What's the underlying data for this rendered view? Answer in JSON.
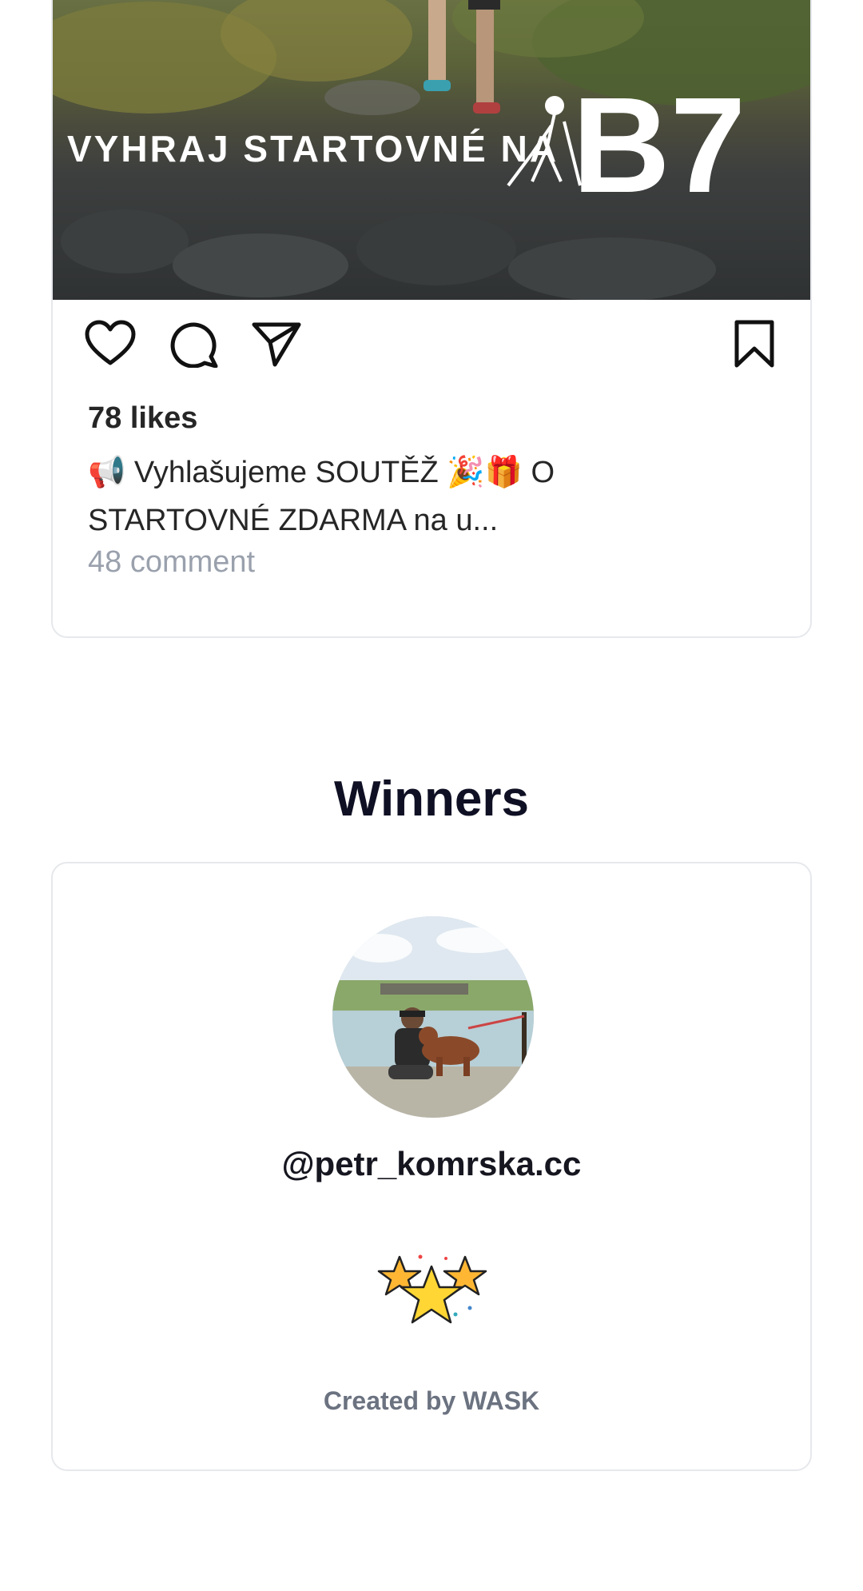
{
  "post": {
    "image_text": "VYHRAJ STARTOVNÉ NA",
    "image_logo": "B7",
    "likes": "78 likes",
    "caption_emoji_1": "📢",
    "caption": "Vyhlašujeme SOUTĚŽ 🎉🎁 O STARTOVNÉ ZDARMA na u...",
    "comments": "48 comment",
    "icons": [
      "heart-icon",
      "comment-icon",
      "share-icon",
      "bookmark-icon"
    ]
  },
  "winners": {
    "title": "Winners",
    "handle": "@petr_komrska.cc",
    "stars_icon": "stars-icon",
    "created_by": "Created by WASK"
  },
  "colors": {
    "title": "#0f1024",
    "muted": "#9aa1ad",
    "border": "#e6e8ec",
    "star": "#ffcf33"
  }
}
